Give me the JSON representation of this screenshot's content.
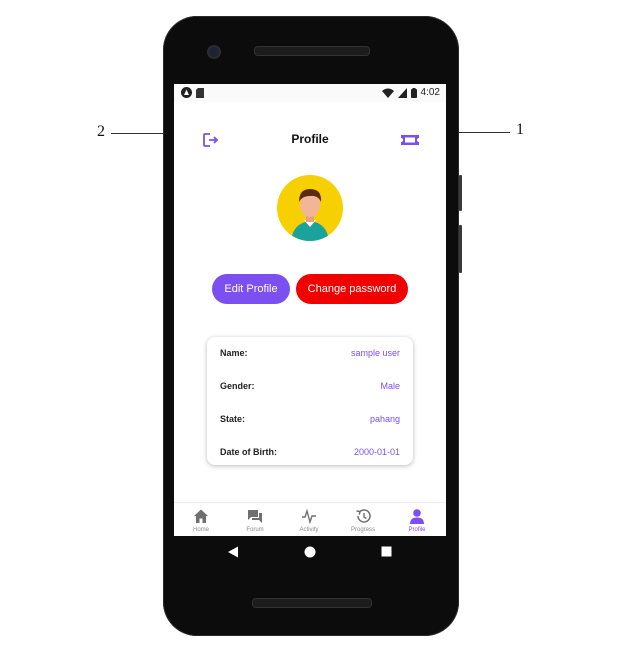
{
  "status_bar": {
    "time": "4:02"
  },
  "header": {
    "title": "Profile"
  },
  "buttons": {
    "edit_profile": "Edit Profile",
    "change_password": "Change password"
  },
  "profile": {
    "rows": [
      {
        "label": "Name:",
        "value": "sample user"
      },
      {
        "label": "Gender:",
        "value": "Male"
      },
      {
        "label": "State:",
        "value": "pahang"
      },
      {
        "label": "Date of Birth:",
        "value": "2000-01-01"
      }
    ]
  },
  "bottom_nav": [
    {
      "label": "Home",
      "icon": "home-icon"
    },
    {
      "label": "Forum",
      "icon": "forum-icon"
    },
    {
      "label": "Activity",
      "icon": "activity-icon"
    },
    {
      "label": "Progress",
      "icon": "progress-icon"
    },
    {
      "label": "Profile",
      "icon": "profile-icon",
      "active": true
    }
  ],
  "callouts": {
    "left": "2",
    "right": "1"
  },
  "colors": {
    "accent": "#7b4ff0",
    "danger": "#f10000",
    "avatar_bg": "#f6d000",
    "nav_inactive": "#8a8a8a"
  }
}
